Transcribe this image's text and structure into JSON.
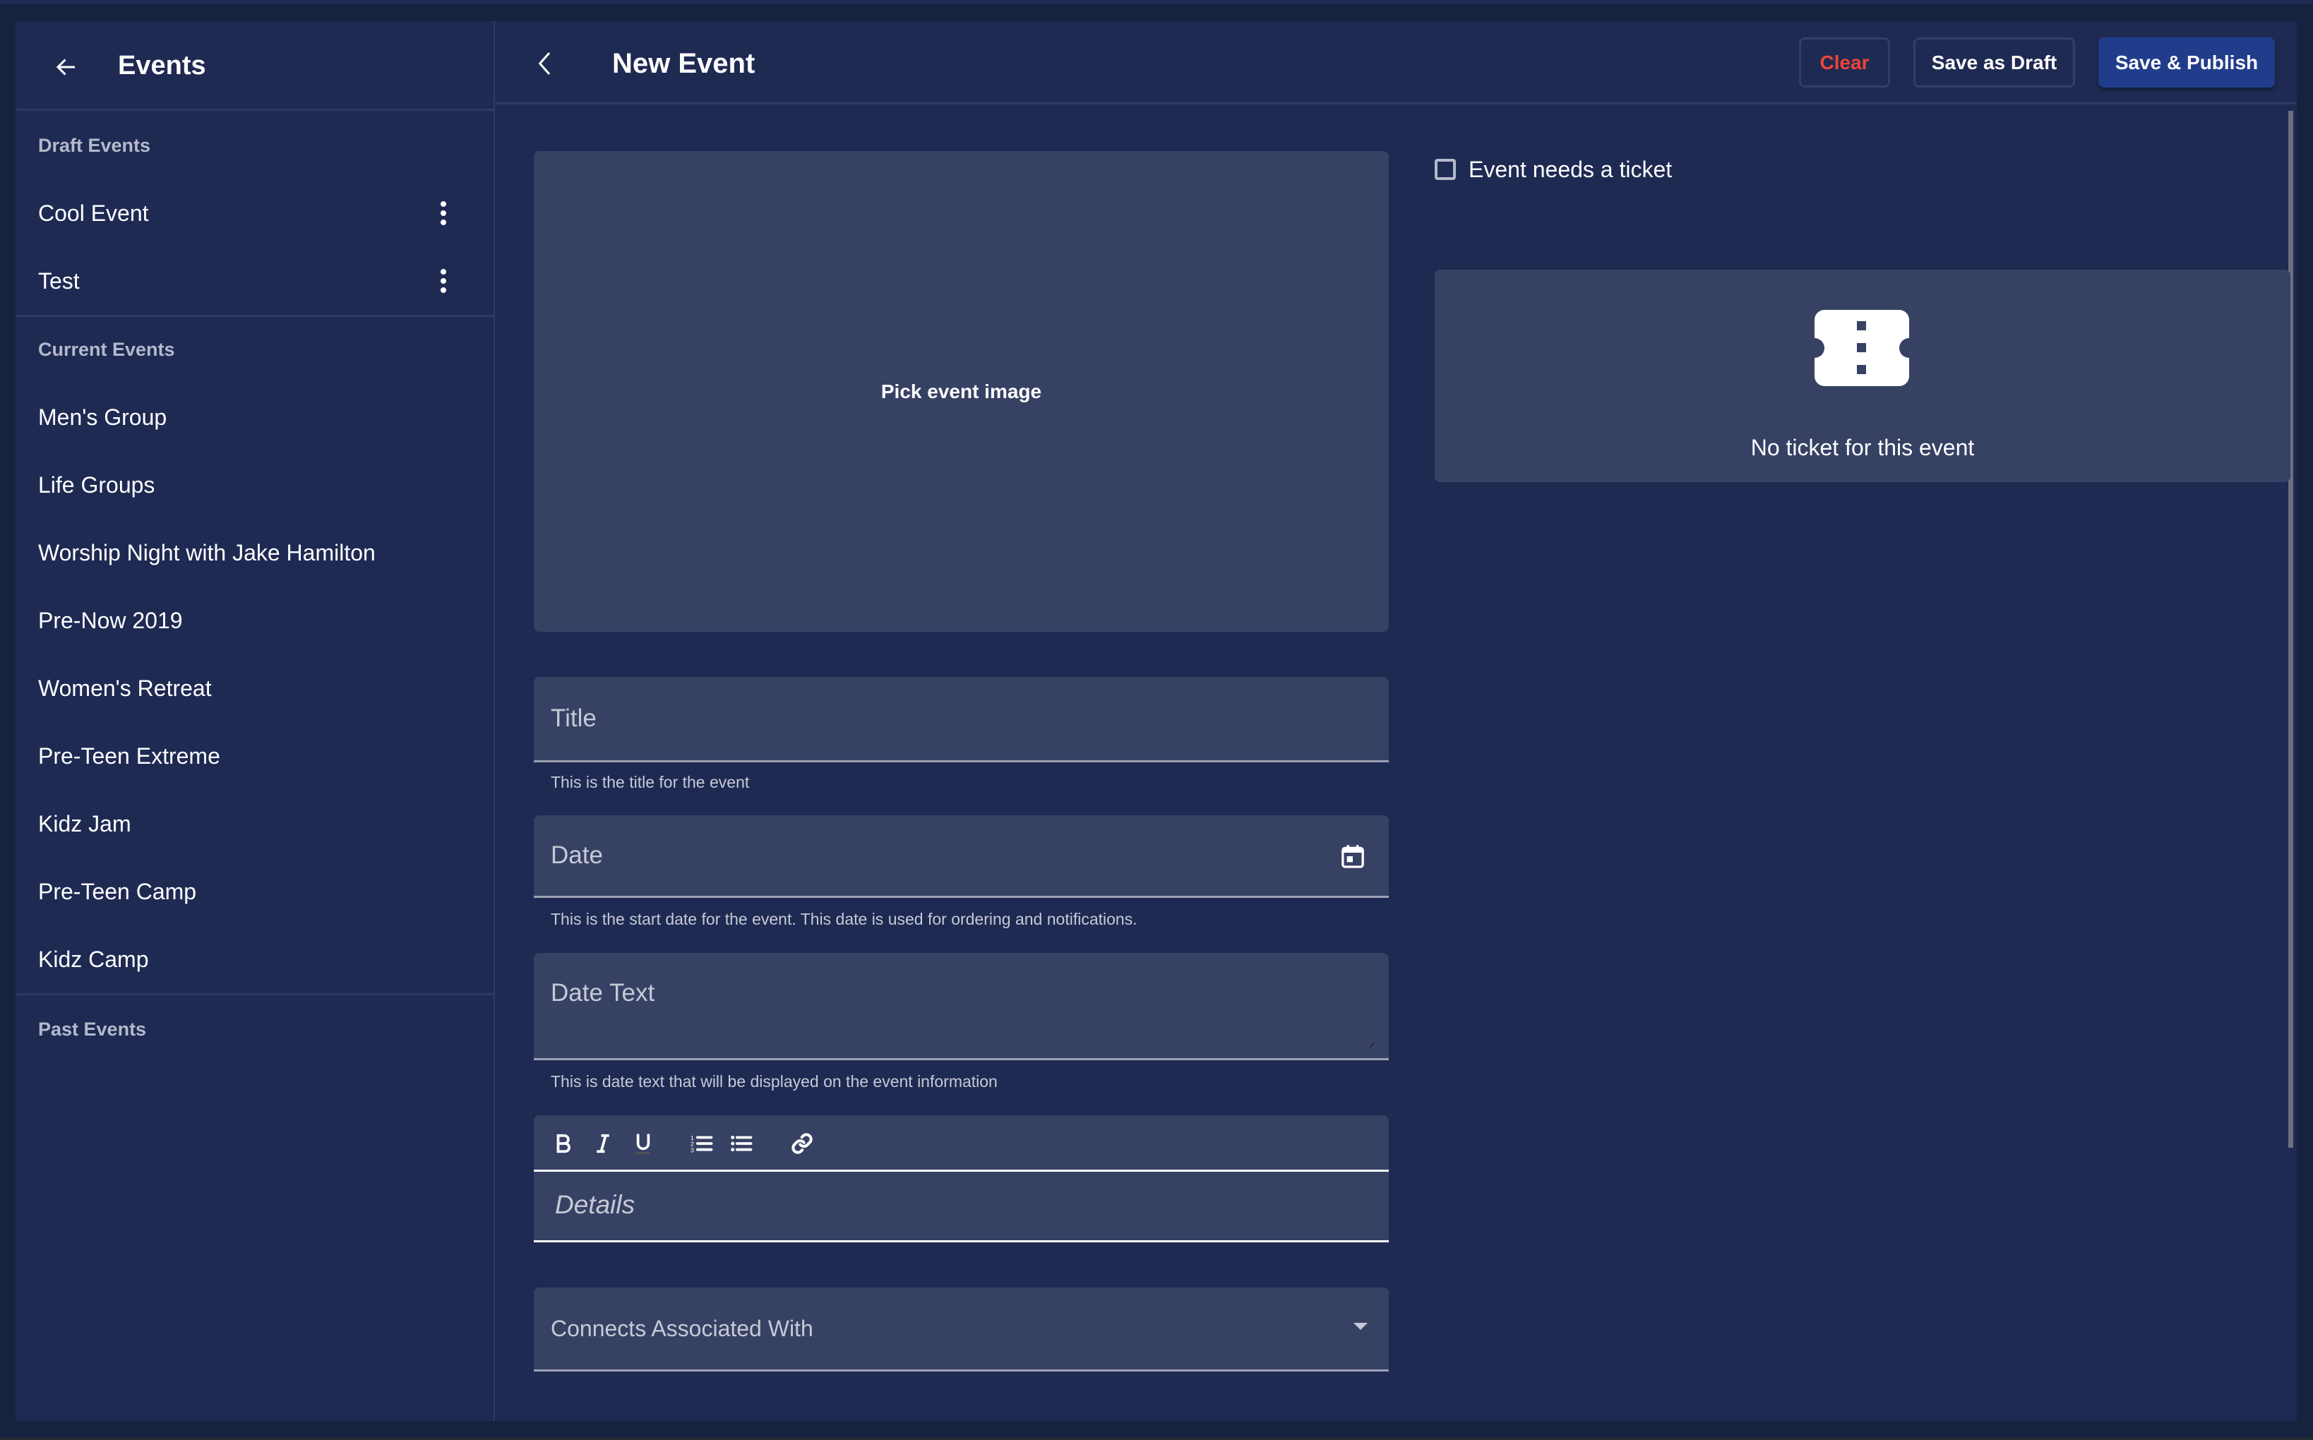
{
  "sidebar": {
    "title": "Events",
    "back_icon": "arrow-left-icon",
    "sections": {
      "draft": {
        "label": "Draft Events",
        "items": [
          {
            "label": "Cool Event",
            "menu_icon": "more-vertical-icon"
          },
          {
            "label": "Test",
            "menu_icon": "more-vertical-icon"
          }
        ]
      },
      "current": {
        "label": "Current Events",
        "items": [
          {
            "label": "Men's Group"
          },
          {
            "label": "Life Groups"
          },
          {
            "label": "Worship Night with Jake Hamilton"
          },
          {
            "label": "Pre-Now 2019"
          },
          {
            "label": "Women's Retreat"
          },
          {
            "label": "Pre-Teen Extreme"
          },
          {
            "label": "Kidz Jam"
          },
          {
            "label": "Pre-Teen Camp"
          },
          {
            "label": "Kidz Camp"
          }
        ]
      },
      "past": {
        "label": "Past Events",
        "items": []
      }
    }
  },
  "header": {
    "title": "New Event",
    "back_icon": "chevron-left-icon",
    "buttons": {
      "clear": "Clear",
      "save_draft": "Save as Draft",
      "save_publish": "Save & Publish"
    }
  },
  "form": {
    "image_picker": "Pick event image",
    "title": {
      "label": "Title",
      "value": "",
      "helper": "This is the title for the event"
    },
    "date": {
      "label": "Date",
      "value": "",
      "helper": "This is the start date for the event. This date is used for ordering and notifications.",
      "icon": "calendar-icon"
    },
    "date_text": {
      "label": "Date Text",
      "value": "",
      "helper": "This is date text that will be displayed on the event information"
    },
    "details": {
      "placeholder": "Details",
      "toolbar": [
        "bold",
        "italic",
        "underline",
        "ordered-list",
        "bullet-list",
        "link"
      ]
    },
    "connects": {
      "label": "Connects Associated With",
      "selected": ""
    }
  },
  "ticket": {
    "checkbox_label": "Event needs a ticket",
    "checked": false,
    "empty_text": "No ticket for this event",
    "icon": "ticket-icon"
  },
  "colors": {
    "background": "#1f2a53",
    "surface": "#374164",
    "accent": "#213c8b",
    "danger": "#ef4438"
  }
}
